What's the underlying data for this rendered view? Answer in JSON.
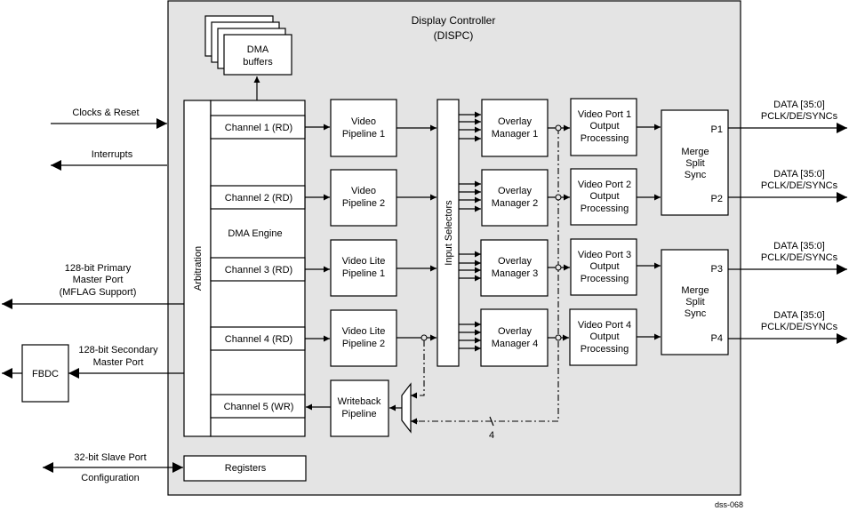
{
  "controller": {
    "title_line1": "Display Controller",
    "title_line2": "(DISPC)",
    "fill": "#e4e4e4"
  },
  "dma_buffers": {
    "line1": "DMA",
    "line2": "buffers"
  },
  "left_signals": {
    "clocks": "Clocks & Reset",
    "interrupts": "Interrupts",
    "primary_line1": "128-bit Primary",
    "primary_line2": "Master Port",
    "primary_line3": "(MFLAG Support)",
    "secondary_line1": "128-bit Secondary",
    "secondary_line2": "Master Port",
    "slave_line1": "32-bit Slave Port",
    "slave_line2": "Configuration"
  },
  "fbdc": "FBDC",
  "arbitration": "Arbitration",
  "dma_engine": {
    "label": "DMA Engine",
    "channels": [
      "Channel 1 (RD)",
      "Channel 2 (RD)",
      "Channel 3 (RD)",
      "Channel 4 (RD)",
      "Channel 5 (WR)"
    ]
  },
  "registers": "Registers",
  "pipelines": [
    {
      "line1": "Video",
      "line2": "Pipeline 1"
    },
    {
      "line1": "Video",
      "line2": "Pipeline 2"
    },
    {
      "line1": "Video Lite",
      "line2": "Pipeline 1"
    },
    {
      "line1": "Video Lite",
      "line2": "Pipeline 2"
    }
  ],
  "writeback": {
    "line1": "Writeback",
    "line2": "Pipeline"
  },
  "input_selectors": "Input Selectors",
  "overlay_managers": [
    {
      "line1": "Overlay",
      "line2": "Manager 1"
    },
    {
      "line1": "Overlay",
      "line2": "Manager 2"
    },
    {
      "line1": "Overlay",
      "line2": "Manager 3"
    },
    {
      "line1": "Overlay",
      "line2": "Manager 4"
    }
  ],
  "video_ports": [
    {
      "line1": "Video Port 1",
      "line2": "Output",
      "line3": "Processing"
    },
    {
      "line1": "Video Port 2",
      "line2": "Output",
      "line3": "Processing"
    },
    {
      "line1": "Video Port 3",
      "line2": "Output",
      "line3": "Processing"
    },
    {
      "line1": "Video Port 4",
      "line2": "Output",
      "line3": "Processing"
    }
  ],
  "merge_blocks": [
    {
      "line1": "Merge",
      "line2": "Split",
      "line3": "Sync",
      "port_a": "P1",
      "port_b": "P2"
    },
    {
      "line1": "Merge",
      "line2": "Split",
      "line3": "Sync",
      "port_a": "P3",
      "port_b": "P4"
    }
  ],
  "outputs": [
    {
      "line1": "DATA [35:0]",
      "line2": "PCLK/DE/SYNCs"
    },
    {
      "line1": "DATA [35:0]",
      "line2": "PCLK/DE/SYNCs"
    },
    {
      "line1": "DATA [35:0]",
      "line2": "PCLK/DE/SYNCs"
    },
    {
      "line1": "DATA [35:0]",
      "line2": "PCLK/DE/SYNCs"
    }
  ],
  "bus_width_label": "4",
  "figure_id": "dss-068"
}
